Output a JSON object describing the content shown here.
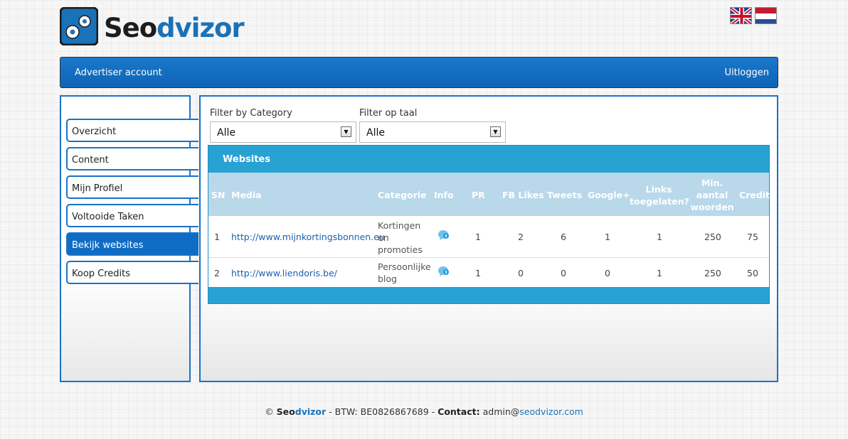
{
  "brand": {
    "name_part1": "Seo",
    "name_part2": "dvizor",
    "colors": {
      "primary": "#0f6cc4",
      "table_header": "#27a2d3"
    }
  },
  "flags": [
    {
      "name": "uk-flag-icon"
    },
    {
      "name": "nl-flag-icon"
    }
  ],
  "topbar": {
    "left_label": "Advertiser account",
    "logout_label": "Uitloggen"
  },
  "sidebar": {
    "items": [
      {
        "label": "Overzicht",
        "active": false
      },
      {
        "label": "Content",
        "active": false
      },
      {
        "label": "Mijn Profiel",
        "active": false
      },
      {
        "label": "Voltooide Taken",
        "active": false
      },
      {
        "label": "Bekijk websites",
        "active": true
      },
      {
        "label": "Koop Credits",
        "active": false
      }
    ]
  },
  "filters": {
    "category": {
      "label": "Filter by Category",
      "value": "Alle"
    },
    "language": {
      "label": "Filter op taal",
      "value": "Alle"
    }
  },
  "table": {
    "title": "Websites",
    "headers": {
      "sn": "SN",
      "media": "Media",
      "categorie": "Categorie",
      "info": "Info",
      "pr": "PR",
      "fb": "FB Likes",
      "tweets": "Tweets",
      "google": "Google+",
      "links_1": "Links",
      "links_2": "toegelaten?",
      "min_1": "Min.",
      "min_2": "aantal",
      "min_3": "woorden",
      "credit": "Credit"
    },
    "rows": [
      {
        "sn": "1",
        "media": "http://www.mijnkortingsbonnen.eu",
        "cat_1": "Kortingen",
        "cat_2": "en",
        "cat_3": "promoties",
        "pr": "1",
        "fb": "2",
        "tweets": "6",
        "google": "1",
        "links": "1",
        "min_words": "250",
        "credit": "75"
      },
      {
        "sn": "2",
        "media": "http://www.liendoris.be/",
        "cat_1": "Persoonlijke",
        "cat_2": "blog",
        "cat_3": "",
        "pr": "1",
        "fb": "0",
        "tweets": "0",
        "google": "0",
        "links": "1",
        "min_words": "250",
        "credit": "50"
      }
    ]
  },
  "footer": {
    "copyright": "©",
    "brand_1": "Seo",
    "brand_2": "dvizor",
    "btw": "- BTW: BE0826867689 -",
    "contact_label": "Contact:",
    "email_1": "admin@",
    "email_2": "seodvizor.com"
  }
}
